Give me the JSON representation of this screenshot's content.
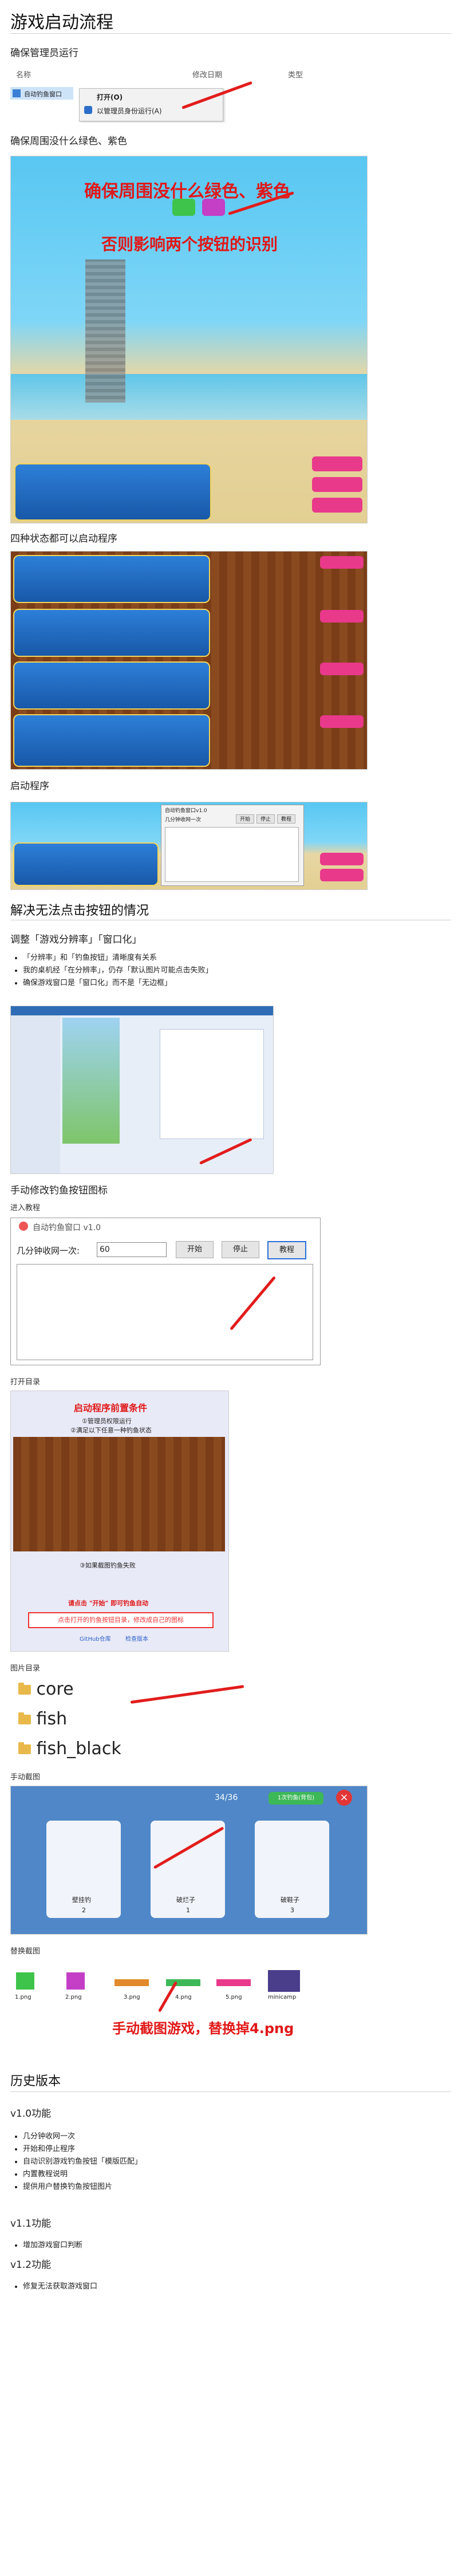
{
  "title": "游戏启动流程",
  "s1": {
    "heading": "确保管理员运行",
    "explorer_cols": [
      "名称",
      "修改日期",
      "类型"
    ],
    "file_name": "自动钓鱼窗口",
    "menu_open": "打开(O)",
    "menu_admin": "以管理员身份运行(A)"
  },
  "s2": {
    "heading": "确保周围没什么绿色、紫色",
    "callout1": "确保周围没什么绿色、紫色",
    "callout2": "否则影响两个按钮的识别"
  },
  "s3": {
    "heading": "四种状态都可以启动程序"
  },
  "s4": {
    "heading": "启动程序",
    "mini_title": "自动钓鱼窗口v1.0",
    "mini_label": "几分钟收网一次",
    "mini_start": "开始",
    "mini_stop": "停止",
    "mini_help": "教程"
  },
  "sec2": {
    "title": "解决无法点击按钮的情况"
  },
  "fix": {
    "heading": "调整「游戏分辨率」「窗口化」",
    "bullets": [
      "「分辨率」和「钓鱼按钮」清晰度有关系",
      "我的桌机经「在分辨率」，仍存「默认图片可能点击失败」",
      "确保游戏窗口是「窗口化」而不是「无边框」"
    ]
  },
  "manual": {
    "heading": "手动修改钓鱼按钮图标",
    "enter_help": "进入教程",
    "win_title": "自动钓鱼窗口 v1.0",
    "label": "几分钟收网一次:",
    "value": "60",
    "start": "开始",
    "stop": "停止",
    "help": "教程",
    "open_dir": "打开目录",
    "cond_title": "启动程序前置条件",
    "cond_1": "①管理员权限运行",
    "cond_2": "②满足以下任意一种钓鱼状态",
    "cond_3": "③如果截图钓鱼失败",
    "cond_4": "请点击 \"开始\" 即可钓鱼自动",
    "cond_5": "点击打开的钓鱼按钮目录，修改成自己的图标",
    "cond_gh": "GitHub仓库",
    "cond_ver": "检查版本",
    "img_dir": "图片目录",
    "folders": [
      "core",
      "fish",
      "fish_black"
    ],
    "manual_shot": "手动截图",
    "shot_counter": "34/36",
    "shot_btn": "1次钓鱼(背包)",
    "items": [
      "壁挂钓",
      "破烂子",
      "破鞋子"
    ],
    "item_counts": [
      "2",
      "1",
      "3"
    ],
    "replace": "替换截图",
    "thumbs": [
      "1.png",
      "2.png",
      "3.png",
      "4.png",
      "5.png",
      "minicamp"
    ],
    "replace_callout": "手动截图游戏，替换掉4.png"
  },
  "history": {
    "title": "历史版本",
    "v10": "v1.0功能",
    "v10_items": [
      "几分钟收网一次",
      "开始和停止程序",
      "自动识别游戏钓鱼按钮「模版匹配」",
      "内置教程说明",
      "提供用户替换钓鱼按钮图片"
    ],
    "v11": "v1.1功能",
    "v11_items": [
      "增加游戏窗口判断"
    ],
    "v12": "v1.2功能",
    "v12_items": [
      "修复无法获取游戏窗口"
    ]
  }
}
